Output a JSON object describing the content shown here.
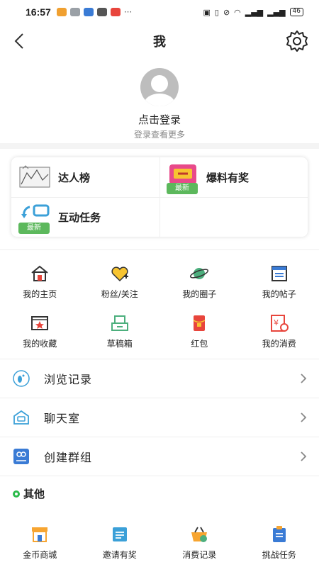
{
  "status": {
    "time": "16:57",
    "battery": "46"
  },
  "header": {
    "title": "我"
  },
  "profile": {
    "login": "点击登录",
    "sub": "登录查看更多"
  },
  "featured": {
    "items": [
      {
        "label": "达人榜"
      },
      {
        "label": "爆料有奖",
        "badge": "最新"
      },
      {
        "label": "互动任务",
        "badge": "最新"
      }
    ]
  },
  "grid": [
    {
      "label": "我的主页",
      "icon": "home-icon"
    },
    {
      "label": "粉丝/关注",
      "icon": "heart-plus-icon"
    },
    {
      "label": "我的圈子",
      "icon": "planet-icon"
    },
    {
      "label": "我的帖子",
      "icon": "posts-icon"
    },
    {
      "label": "我的收藏",
      "icon": "star-folder-icon"
    },
    {
      "label": "草稿箱",
      "icon": "drafts-icon"
    },
    {
      "label": "红包",
      "icon": "red-packet-icon"
    },
    {
      "label": "我的消费",
      "icon": "consumption-icon"
    }
  ],
  "list": [
    {
      "label": "浏览记录",
      "icon": "footprint-icon"
    },
    {
      "label": "聊天室",
      "icon": "chatroom-icon"
    },
    {
      "label": "创建群组",
      "icon": "create-group-icon"
    }
  ],
  "other": {
    "title": "其他",
    "items": [
      {
        "label": "金币商城",
        "icon": "shop-icon"
      },
      {
        "label": "邀请有奖",
        "icon": "invite-icon"
      },
      {
        "label": "消费记录",
        "icon": "basket-icon"
      },
      {
        "label": "挑战任务",
        "icon": "clipboard-icon"
      }
    ]
  },
  "colors": {
    "accent_green": "#2bbb4a",
    "badge_green": "#5cb85c",
    "red": "#e8453c",
    "blue": "#3a7bd5"
  }
}
